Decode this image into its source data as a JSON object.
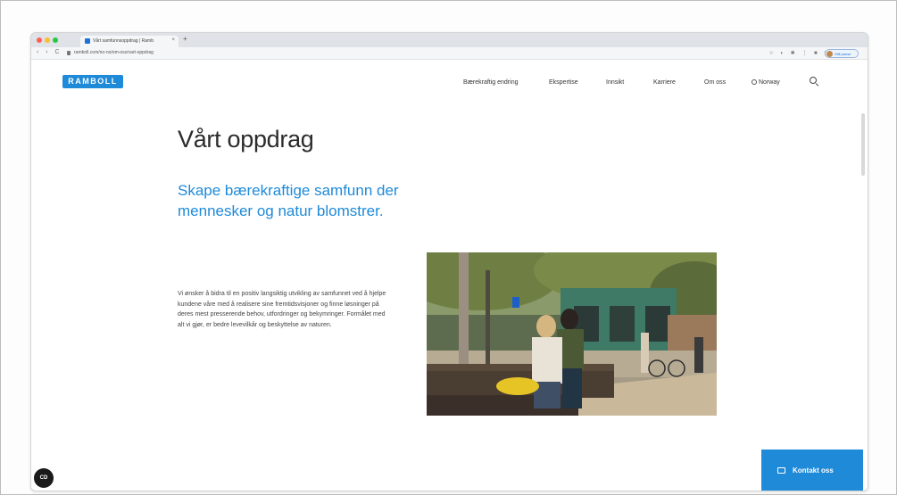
{
  "browser": {
    "tab_title": "Vårt samfunnsoppdrag | Ramb",
    "tab_close": "×",
    "new_tab": "+",
    "url": "ramboll.com/no-no/om-oss/vart-oppdrag",
    "nav_buttons": "‹ › C",
    "toolbar_icons": "☆ ◐ ✱ ⋮ ■ ◫",
    "profile_label": "Still pause",
    "colors": {
      "close": "#ff5f57",
      "minimize": "#febc2e",
      "maximize": "#28c840"
    }
  },
  "site": {
    "logo": "RAMBOLL",
    "brand_color": "#1e8ad8",
    "nav": [
      {
        "label": "Bærekraftig endring"
      },
      {
        "label": "Ekspertise"
      },
      {
        "label": "Innsikt"
      },
      {
        "label": "Karriere"
      },
      {
        "label": "Om oss"
      },
      {
        "label": "Norway"
      }
    ],
    "search_icon": "search-icon"
  },
  "main": {
    "title": "Vårt oppdrag",
    "subtitle": "Skape bærekraftige samfunn der mennesker og natur blomstrer.",
    "body": "Vi ønsker å bidra til en positiv langsiktig utvikling av samfunnet ved å hjelpe kundene våre med å realisere sine fremtidsvisjoner og finne løsninger på deres mest presserende behov, utfordringer og bekymringer. Formålet med alt vi gjør, er bedre levevilkår og beskyttelse av naturen."
  },
  "widgets": {
    "chat_badge": "CD",
    "contact_label": "Kontakt oss"
  }
}
